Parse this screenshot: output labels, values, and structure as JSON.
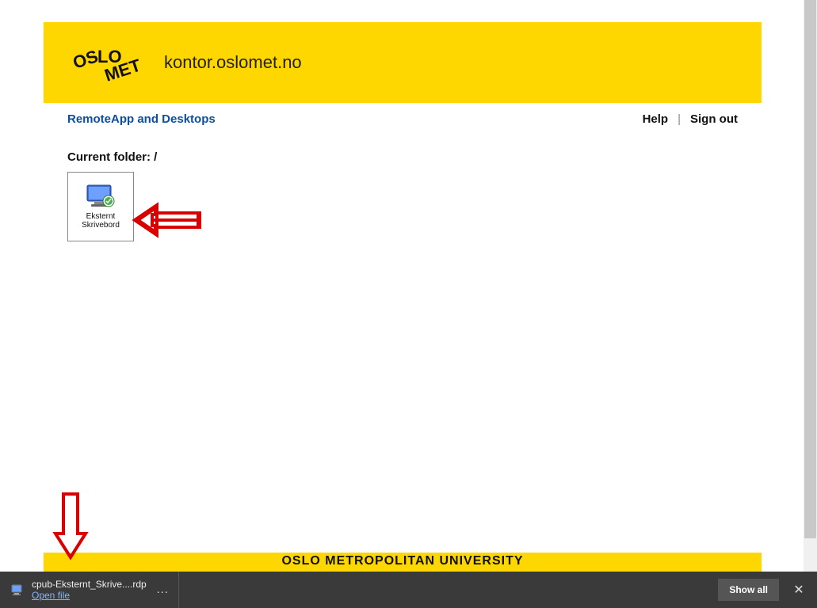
{
  "header": {
    "logo_text": "OSLOMET",
    "site_title": "kontor.oslomet.no"
  },
  "nav": {
    "section": "RemoteApp and Desktops",
    "help": "Help",
    "signout": "Sign out",
    "separator": "|"
  },
  "content": {
    "folder_label": "Current folder: /",
    "apps": [
      {
        "name": "Eksternt Skrivebord",
        "icon": "remote-desktop-icon"
      }
    ]
  },
  "footer": {
    "text": "OSLO METROPOLITAN UNIVERSITY"
  },
  "download_bar": {
    "filename": "cpub-Eksternt_Skrive....rdp",
    "open_label": "Open file",
    "more": "…",
    "show_all": "Show all",
    "close": "✕"
  },
  "colors": {
    "brand_yellow": "#ffd700",
    "link_blue": "#0a4fa0"
  }
}
